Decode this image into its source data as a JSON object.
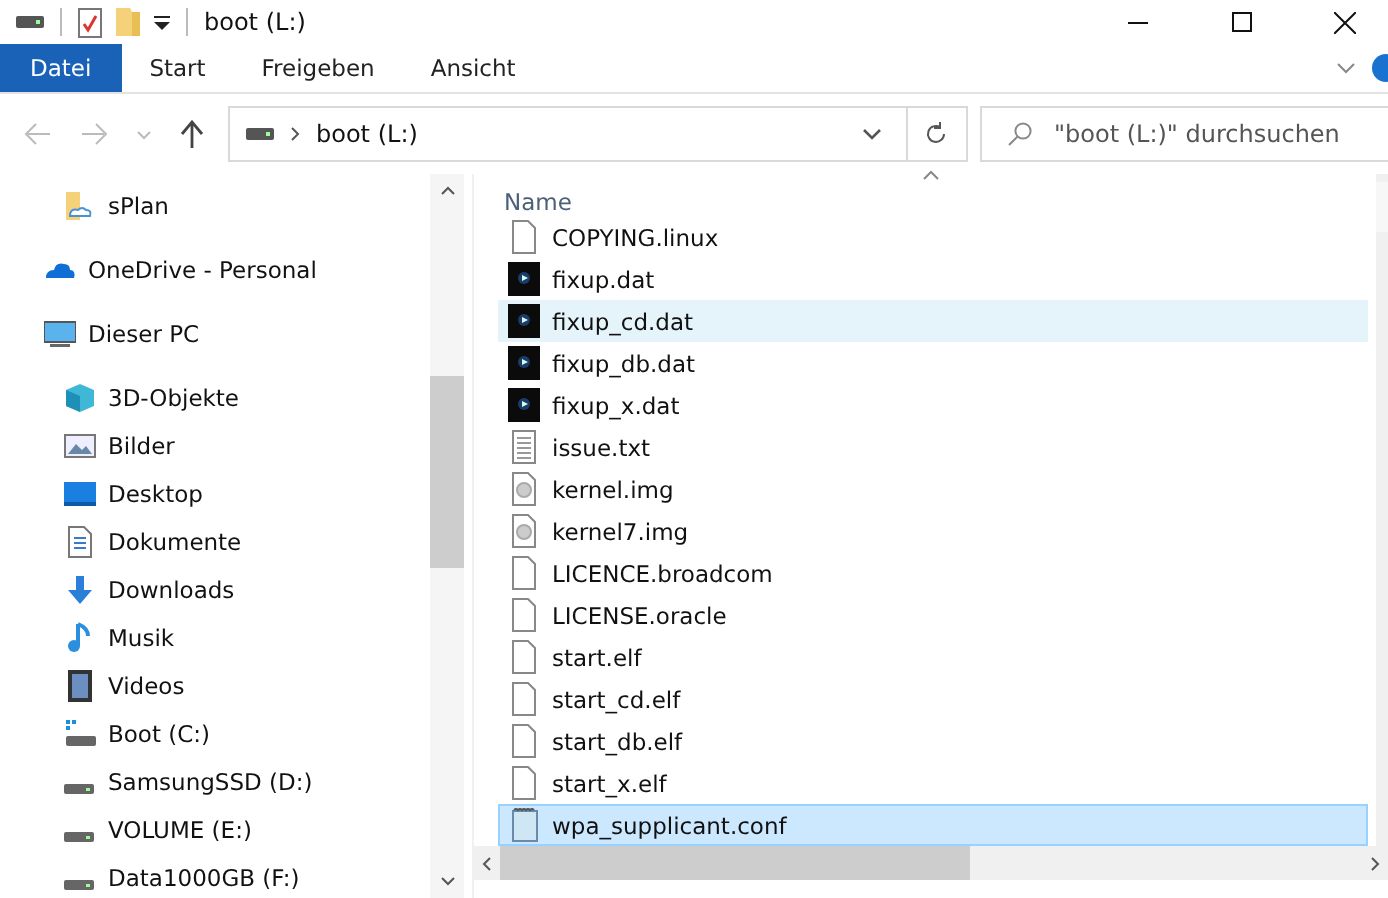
{
  "window": {
    "title": "boot (L:)"
  },
  "ribbon": {
    "tabs": [
      {
        "label": "Datei",
        "selected": true
      },
      {
        "label": "Start",
        "selected": false
      },
      {
        "label": "Freigeben",
        "selected": false
      },
      {
        "label": "Ansicht",
        "selected": false
      }
    ]
  },
  "navigation": {
    "buttons": [
      {
        "kind": "back",
        "disabled": true
      },
      {
        "kind": "forward",
        "disabled": true
      }
    ]
  },
  "address_bar": {
    "path": [
      "boot (L:)"
    ]
  },
  "search": {
    "placeholder": "\"boot (L:)\" durchsuchen"
  },
  "sidebar": {
    "items": [
      {
        "label": "sPlan",
        "kind": "pinned"
      },
      {
        "label": "OneDrive - Personal",
        "kind": "cloud"
      },
      {
        "label": "Dieser PC",
        "kind": "computer",
        "children": [
          {
            "label": "3D-Objekte",
            "kind": "objects"
          },
          {
            "label": "Bilder",
            "kind": "pictures"
          },
          {
            "label": "Desktop",
            "kind": "desktop"
          },
          {
            "label": "Dokumente",
            "kind": "documents"
          },
          {
            "label": "Downloads",
            "kind": "downloads"
          },
          {
            "label": "Musik",
            "kind": "music"
          },
          {
            "label": "Videos",
            "kind": "videos"
          },
          {
            "label": "Boot (C:)",
            "kind": "system-drive"
          },
          {
            "label": "SamsungSSD (D:)",
            "kind": "drive"
          },
          {
            "label": "VOLUME (E:)",
            "kind": "drive"
          },
          {
            "label": "Data1000GB (F:)",
            "kind": "drive"
          }
        ]
      }
    ]
  },
  "file_list": {
    "columns": [
      {
        "label": "Name"
      }
    ],
    "rows": [
      {
        "name": "COPYING.linux",
        "kind": "blank",
        "selected": false,
        "hovered": false
      },
      {
        "name": "fixup.dat",
        "kind": "media",
        "selected": false,
        "hovered": false
      },
      {
        "name": "fixup_cd.dat",
        "kind": "media",
        "selected": false,
        "hovered": true
      },
      {
        "name": "fixup_db.dat",
        "kind": "media",
        "selected": false,
        "hovered": false
      },
      {
        "name": "fixup_x.dat",
        "kind": "media",
        "selected": false,
        "hovered": false
      },
      {
        "name": "issue.txt",
        "kind": "text",
        "selected": false,
        "hovered": false
      },
      {
        "name": "kernel.img",
        "kind": "image",
        "selected": false,
        "hovered": false
      },
      {
        "name": "kernel7.img",
        "kind": "image",
        "selected": false,
        "hovered": false
      },
      {
        "name": "LICENCE.broadcom",
        "kind": "blank",
        "selected": false,
        "hovered": false
      },
      {
        "name": "LICENSE.oracle",
        "kind": "blank",
        "selected": false,
        "hovered": false
      },
      {
        "name": "start.elf",
        "kind": "blank",
        "selected": false,
        "hovered": false
      },
      {
        "name": "start_cd.elf",
        "kind": "blank",
        "selected": false,
        "hovered": false
      },
      {
        "name": "start_db.elf",
        "kind": "blank",
        "selected": false,
        "hovered": false
      },
      {
        "name": "start_x.elf",
        "kind": "blank",
        "selected": false,
        "hovered": false
      },
      {
        "name": "wpa_supplicant.conf",
        "kind": "config",
        "selected": true,
        "hovered": false
      }
    ]
  }
}
